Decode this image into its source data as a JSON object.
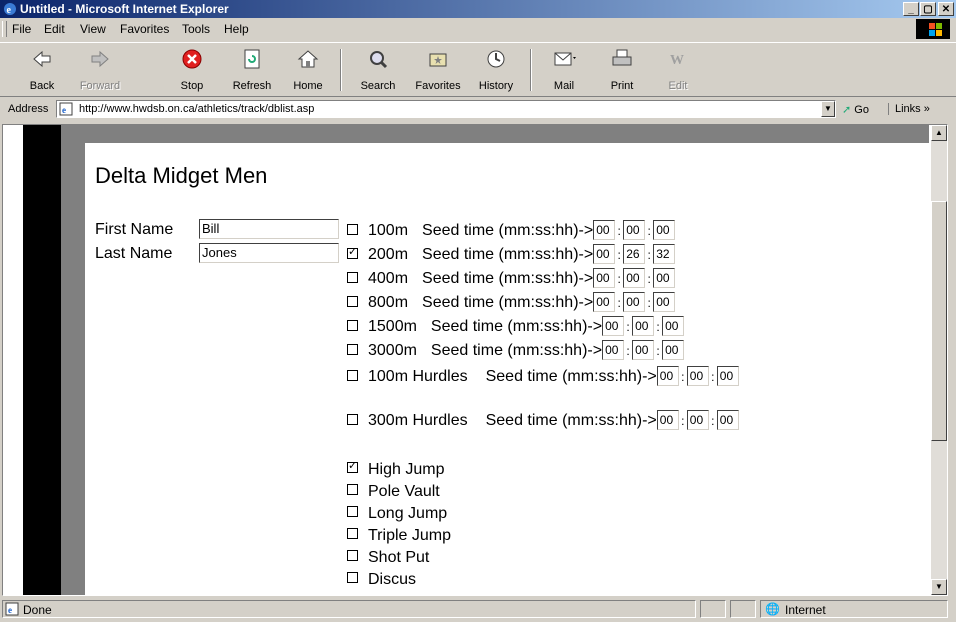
{
  "window": {
    "title": "Untitled - Microsoft Internet Explorer",
    "controls": [
      "_",
      "▢",
      "✕"
    ]
  },
  "menu": [
    "File",
    "Edit",
    "View",
    "Favorites",
    "Tools",
    "Help"
  ],
  "toolbar": {
    "back": "Back",
    "forward": "Forward",
    "stop": "Stop",
    "refresh": "Refresh",
    "home": "Home",
    "search": "Search",
    "favorites": "Favorites",
    "history": "History",
    "mail": "Mail",
    "print": "Print",
    "edit": "Edit"
  },
  "address": {
    "label": "Address",
    "url": "http://www.hwdsb.on.ca/athletics/track/dblist.asp",
    "go": "Go",
    "links": "Links »"
  },
  "page": {
    "title": "Delta Midget Men",
    "first_name_label": "First Name",
    "first_name": "Bill",
    "last_name_label": "Last Name",
    "last_name": "Jones",
    "seed_label": "Seed time (mm:ss:hh)->",
    "events": [
      {
        "name": "100m",
        "checked": false,
        "mm": "00",
        "ss": "00",
        "hh": "00"
      },
      {
        "name": "200m",
        "checked": true,
        "mm": "00",
        "ss": "26",
        "hh": "32"
      },
      {
        "name": "400m",
        "checked": false,
        "mm": "00",
        "ss": "00",
        "hh": "00"
      },
      {
        "name": "800m",
        "checked": false,
        "mm": "00",
        "ss": "00",
        "hh": "00"
      },
      {
        "name": "1500m",
        "checked": false,
        "mm": "00",
        "ss": "00",
        "hh": "00"
      },
      {
        "name": "3000m",
        "checked": false,
        "mm": "00",
        "ss": "00",
        "hh": "00"
      },
      {
        "name": "100m Hurdles",
        "checked": false,
        "mm": "00",
        "ss": "00",
        "hh": "00"
      },
      {
        "name": "300m Hurdles",
        "checked": false,
        "mm": "00",
        "ss": "00",
        "hh": "00"
      }
    ],
    "field_events": [
      {
        "name": "High Jump",
        "checked": true
      },
      {
        "name": "Pole Vault",
        "checked": false
      },
      {
        "name": "Long Jump",
        "checked": false
      },
      {
        "name": "Triple Jump",
        "checked": false
      },
      {
        "name": "Shot Put",
        "checked": false
      },
      {
        "name": "Discus",
        "checked": false
      }
    ]
  },
  "status": {
    "text": "Done",
    "zone": "Internet"
  }
}
